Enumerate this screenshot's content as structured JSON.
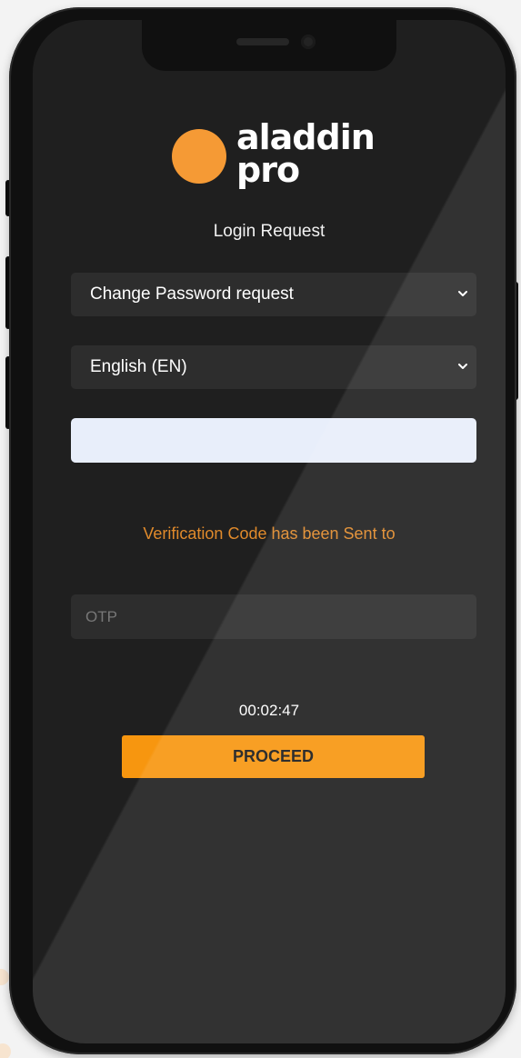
{
  "brand": {
    "logo_line1": "aladdin",
    "logo_line2": "pro",
    "accent_color": "#f59a35"
  },
  "page": {
    "title": "Login Request"
  },
  "form": {
    "request_type": {
      "selected": "Change Password request",
      "icon": "chevron-down-icon"
    },
    "language": {
      "selected": "English (EN)",
      "icon": "chevron-down-icon"
    },
    "identifier_input": {
      "value": "",
      "placeholder": ""
    },
    "notice": "Verification Code has been Sent to",
    "otp": {
      "value": "",
      "placeholder": "OTP"
    },
    "timer": "00:02:47",
    "proceed_label": "PROCEED",
    "proceed_color": "#f7960f"
  }
}
